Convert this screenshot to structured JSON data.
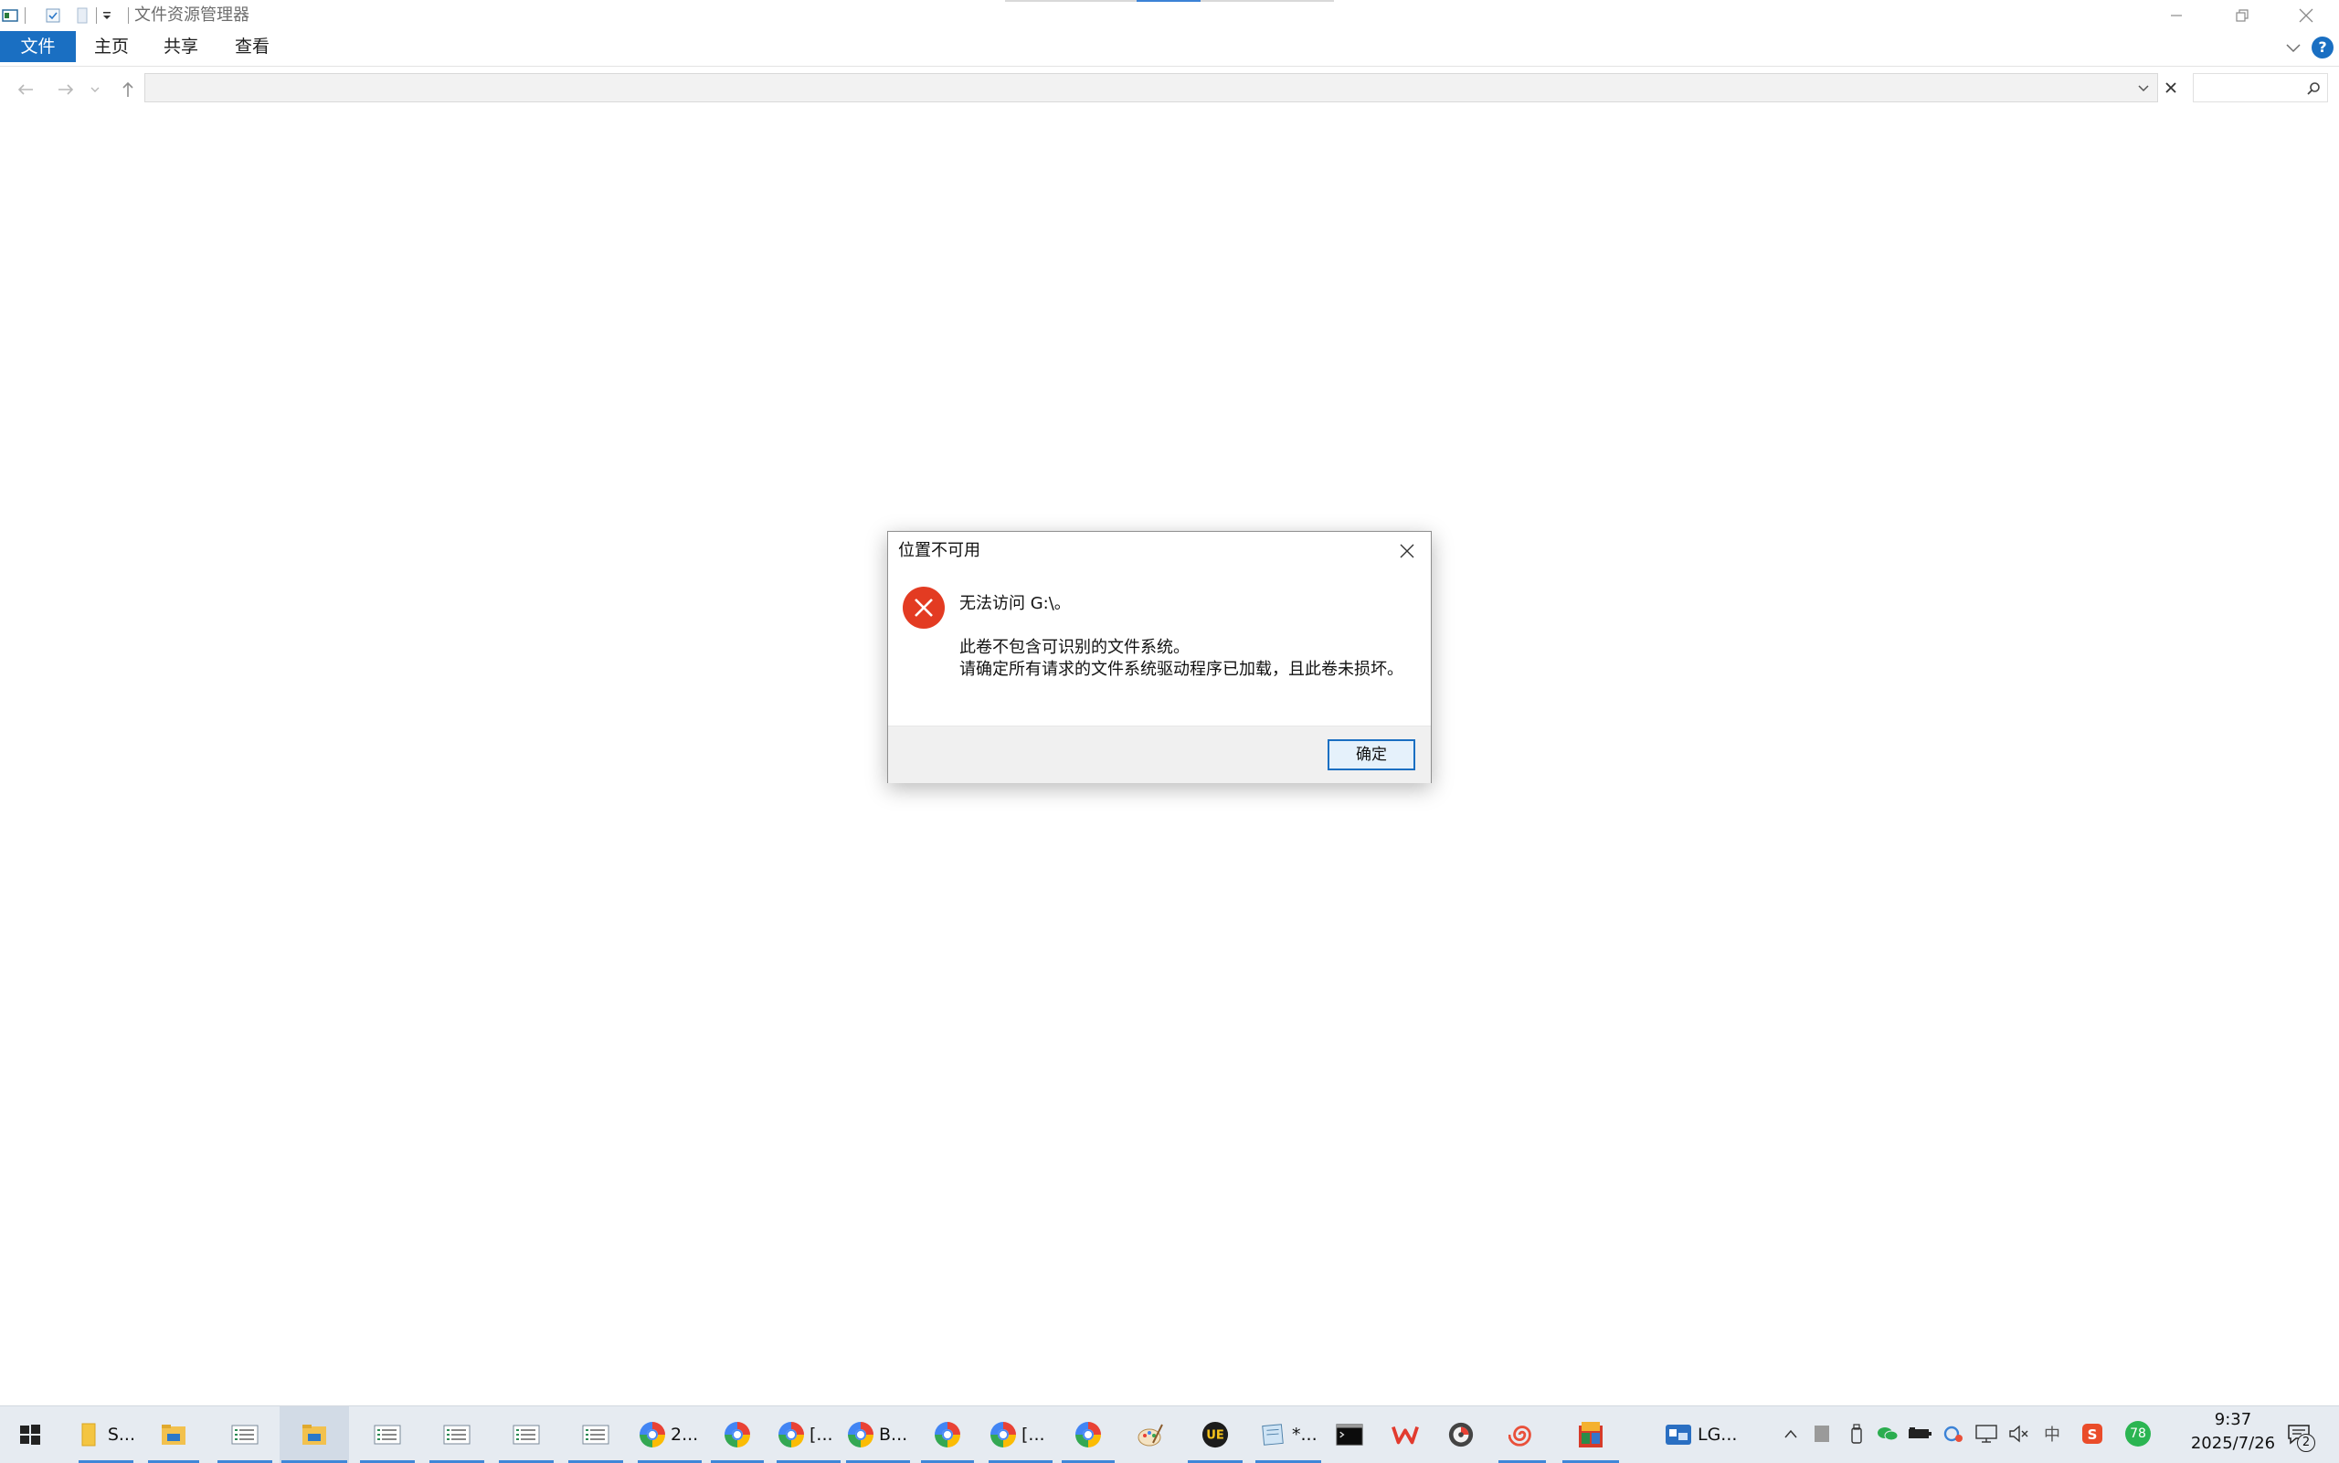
{
  "window": {
    "title": "文件资源管理器"
  },
  "ribbon": {
    "tabs": [
      "文件",
      "主页",
      "共享",
      "查看"
    ],
    "help_label": "?"
  },
  "navbar": {
    "address_value": "",
    "search_placeholder": ""
  },
  "dialog": {
    "title": "位置不可用",
    "message_main": "无法访问 G:\\。",
    "message_line1": "此卷不包含可识别的文件系统。",
    "message_line2": "请确定所有请求的文件系统驱动程序已加载，且此卷未损坏。",
    "ok_label": "确定",
    "icon": "error-icon"
  },
  "taskbar": {
    "items": [
      {
        "icon": "start-icon",
        "label": ""
      },
      {
        "icon": "folder-icon",
        "label": "S..."
      },
      {
        "icon": "file-explorer-icon",
        "label": ""
      },
      {
        "icon": "document-list-icon",
        "label": ""
      },
      {
        "icon": "file-explorer-icon",
        "label": ""
      },
      {
        "icon": "document-list-icon",
        "label": ""
      },
      {
        "icon": "document-list-icon",
        "label": ""
      },
      {
        "icon": "document-list-icon",
        "label": ""
      },
      {
        "icon": "document-list-icon",
        "label": ""
      },
      {
        "icon": "chrome-icon",
        "label": "2..."
      },
      {
        "icon": "chrome-icon",
        "label": ""
      },
      {
        "icon": "chrome-icon",
        "label": "[..."
      },
      {
        "icon": "chrome-icon",
        "label": "B..."
      },
      {
        "icon": "chrome-icon",
        "label": ""
      },
      {
        "icon": "chrome-icon",
        "label": "[..."
      },
      {
        "icon": "chrome-icon",
        "label": ""
      },
      {
        "icon": "paint-icon",
        "label": ""
      },
      {
        "icon": "ultraedit-icon",
        "label": ""
      },
      {
        "icon": "notepad-icon",
        "label": "*..."
      },
      {
        "icon": "terminal-icon",
        "label": ""
      },
      {
        "icon": "wps-icon",
        "label": ""
      },
      {
        "icon": "disk-tool-icon",
        "label": ""
      },
      {
        "icon": "spiral-app-icon",
        "label": ""
      },
      {
        "icon": "hjc-app-icon",
        "label": ""
      },
      {
        "icon": "lg-app-icon",
        "label": "LG..."
      }
    ],
    "tray": {
      "battery_badge": "78",
      "ime_label": "中",
      "time": "9:37",
      "date": "2025/7/26",
      "notification_count": "2"
    }
  },
  "colors": {
    "accent": "#1a6fc2",
    "error": "#e33b22",
    "taskbar": "#e6ebf1"
  }
}
